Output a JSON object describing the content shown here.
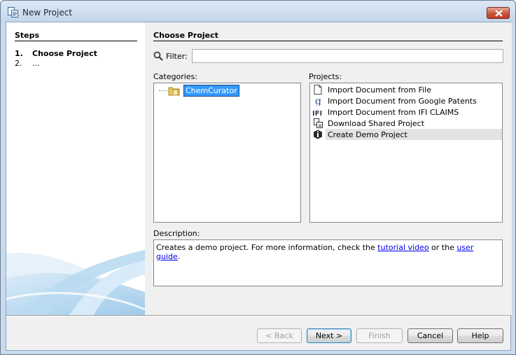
{
  "window": {
    "title": "New Project",
    "icons": {
      "app": "new-project-icon",
      "close": "close-icon"
    }
  },
  "steps": {
    "title": "Steps",
    "items": [
      {
        "num": "1.",
        "label": "Choose Project",
        "current": true
      },
      {
        "num": "2.",
        "label": "...",
        "current": false
      }
    ]
  },
  "main": {
    "title": "Choose Project",
    "filter": {
      "label": "Filter:",
      "value": "",
      "placeholder": "",
      "icon": "search-icon"
    },
    "categories": {
      "label": "Categories:",
      "items": [
        {
          "label": "ChemCurator",
          "icon": "folder-icon",
          "selected": true
        }
      ]
    },
    "projects": {
      "label": "Projects:",
      "items": [
        {
          "label": "Import Document from File",
          "icon": "document-icon"
        },
        {
          "label": "Import Document from Google Patents",
          "icon": "google-icon"
        },
        {
          "label": "Import Document from IFI CLAIMS",
          "icon": "ifi-icon"
        },
        {
          "label": "Download Shared Project",
          "icon": "shared-project-icon"
        },
        {
          "label": "Create Demo Project",
          "icon": "demo-project-icon",
          "selected": true
        }
      ]
    },
    "description": {
      "label": "Description:",
      "text_before": "Creates a demo project. For more information, check the ",
      "link1": "tutorial video",
      "text_middle": " or the ",
      "link2": "user guide",
      "text_after": "."
    }
  },
  "buttons": {
    "back": "< Back",
    "next": "Next >",
    "finish": "Finish",
    "cancel": "Cancel",
    "help": "Help"
  },
  "colors": {
    "selection": "#3399ff",
    "accent_swoosh": "#a9d0ec",
    "link": "#0000ee"
  }
}
